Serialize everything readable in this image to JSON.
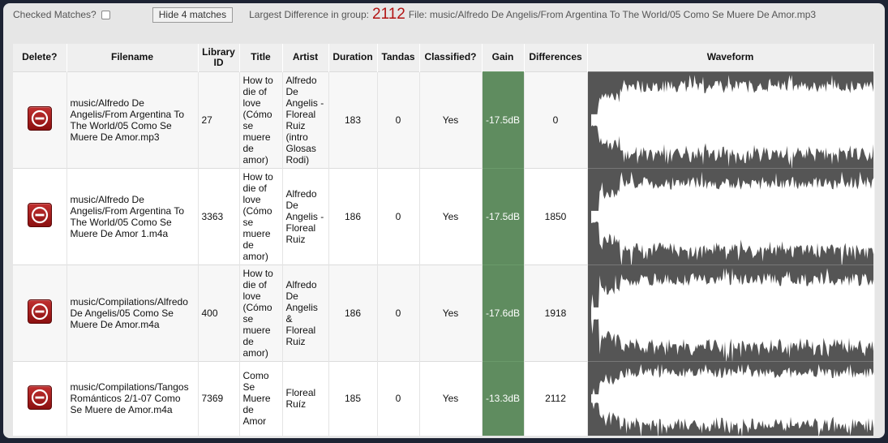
{
  "topbar": {
    "checked_label": "Checked Matches?",
    "hide_button": "Hide 4 matches",
    "largest_label": "Largest Difference in group:",
    "largest_value": "2112",
    "file_info": "File: music/Alfredo De Angelis/From Argentina To The World/05 Como Se Muere De Amor.mp3"
  },
  "columns": [
    "Delete?",
    "Filename",
    "Library ID",
    "Title",
    "Artist",
    "Duration",
    "Tandas",
    "Classified?",
    "Gain",
    "Differences",
    "Waveform"
  ],
  "rows": [
    {
      "filename": "music/Alfredo De Angelis/From Argentina To The World/05 Como Se Muere De Amor.mp3",
      "library_id": "27",
      "title": "How to die of love (Cómo se muere de amor)",
      "artist": "Alfredo De Angelis - Floreal Ruiz (intro Glosas Rodi)",
      "duration": "183",
      "tandas": "0",
      "classified": "Yes",
      "gain": "-17.5dB",
      "differences": "0"
    },
    {
      "filename": "music/Alfredo De Angelis/From Argentina To The World/05 Como Se Muere De Amor 1.m4a",
      "library_id": "3363",
      "title": "How to die of love (Cómo se muere de amor)",
      "artist": "Alfredo De Angelis - Floreal Ruiz",
      "duration": "186",
      "tandas": "0",
      "classified": "Yes",
      "gain": "-17.5dB",
      "differences": "1850"
    },
    {
      "filename": "music/Compilations/Alfredo De Angelis/05 Como Se Muere De Amor.m4a",
      "library_id": "400",
      "title": "How to die of love (Cómo se muere de amor)",
      "artist": "Alfredo De Angelis & Floreal Ruiz",
      "duration": "186",
      "tandas": "0",
      "classified": "Yes",
      "gain": "-17.6dB",
      "differences": "1918"
    },
    {
      "filename": "music/Compilations/Tangos Románticos 2/1-07 Como Se Muere de Amor.m4a",
      "library_id": "7369",
      "title": "Como Se Muere de Amor",
      "artist": "Floreal Ruíz",
      "duration": "185",
      "tandas": "0",
      "classified": "Yes",
      "gain": "-13.3dB",
      "differences": "2112"
    }
  ],
  "colors": {
    "gain_cell": "#5f8c5f",
    "waveform_bg": "#555555",
    "largest_value": "#b31414",
    "delete_button": "#a51c1c"
  },
  "icons": {
    "delete": "minus-circle-icon"
  }
}
